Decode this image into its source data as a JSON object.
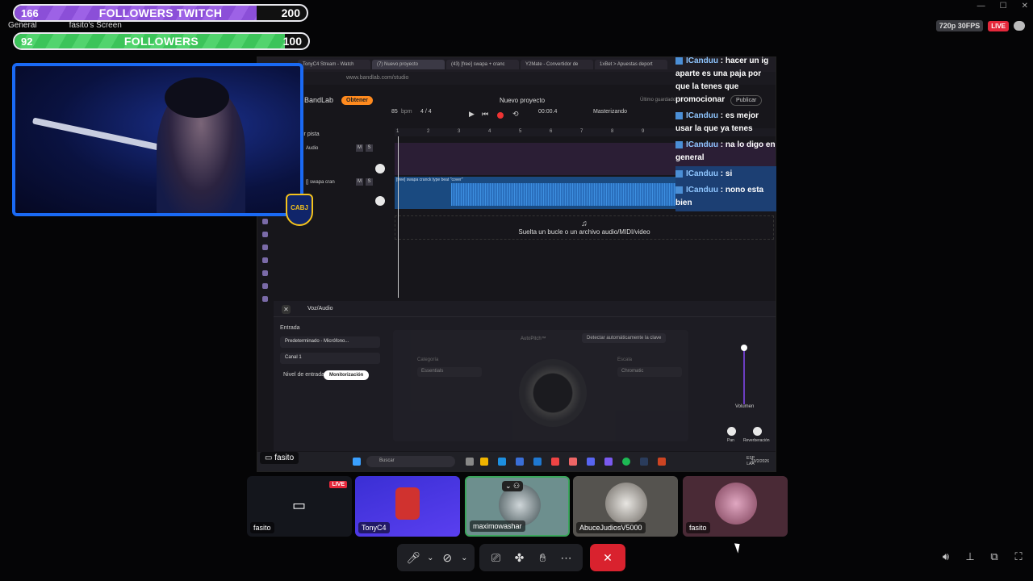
{
  "followers_twitch": {
    "current": "166",
    "label": "FOLLOWERS TWITCH",
    "goal": "200",
    "progress": 0.83
  },
  "followers": {
    "current": "92",
    "label": "FOLLOWERS",
    "goal": "100",
    "progress": 0.92
  },
  "discord": {
    "channel": "General",
    "screen_label": "fasito's Screen"
  },
  "stream": {
    "quality": "720p 30FPS",
    "live": "LIVE"
  },
  "browser": {
    "tabs": [
      "TonyC4 Stream - Watch",
      "(7) Nuevo proyecto",
      "(43) [free] swapa + cranc",
      "Y2Mate - Convertidor de",
      "1xBet > Apuestas deport"
    ],
    "url": "www.bandlab.com/studio"
  },
  "bandlab": {
    "logo": "BandLab",
    "obtener": "Obtener",
    "project_title": "Nuevo proyecto",
    "publicar": "Publicar",
    "guardado": "Último guardado",
    "bpm": "85",
    "bpm_unit": "bpm",
    "time_sig": "4 / 4",
    "time": "00:00.4",
    "master": "Masterizando",
    "add_track": "ir pista",
    "track1": "Audio",
    "track2": "[] swapa cran",
    "clip_name": "[free] swapa cranck type beat \"cover\"",
    "drop_hint": "Suelta un bucle o un archivo audio/MIDI/video",
    "ruler": [
      "1",
      "2",
      "3",
      "4",
      "5",
      "6",
      "7",
      "8",
      "9"
    ],
    "panel_title": "Voz/Audio",
    "entrada": "Entrada",
    "input_device": "Predeterminado - Micrófono...",
    "channel": "Canal 1",
    "nivel": "Nivel de entrada",
    "monitor": "Monitorización",
    "autopitch": "AutoPitch™",
    "detect": "Detectar automáticamente la clave",
    "categoria": "Categoría",
    "categoria_val": "Essentials",
    "escala": "Escala",
    "escala_val": "Chromatic",
    "volumen": "Volumen",
    "pan": "Pan",
    "reverb": "Reverberación"
  },
  "taskbar": {
    "search": "Buscar",
    "lang": "ESP",
    "lang2": "LAA",
    "date": "23/2/2026"
  },
  "chat": [
    {
      "user": "ICanduu",
      "text": ": hacer un ig aparte es una paja por que la tenes que promocionar"
    },
    {
      "user": "ICanduu",
      "text": ": es mejor usar la que ya tenes"
    },
    {
      "user": "ICanduu",
      "text": ": na lo digo en general"
    },
    {
      "user": "ICanduu",
      "text": ": si"
    },
    {
      "user": "ICanduu",
      "text": ": nono esta bien"
    }
  ],
  "screen_owner": "fasito",
  "cam_badge": "CABJ",
  "participants": [
    {
      "name": "fasito",
      "live": "LIVE"
    },
    {
      "name": "TonyC4"
    },
    {
      "name": "maximowashar"
    },
    {
      "name": "AbuceJudiosV5000"
    },
    {
      "name": "fasito"
    }
  ],
  "colors": {
    "twitch_purple": "#8b4fd8",
    "green": "#3cc45a",
    "cam_border": "#1a6af5",
    "end_call": "#d9222e"
  }
}
